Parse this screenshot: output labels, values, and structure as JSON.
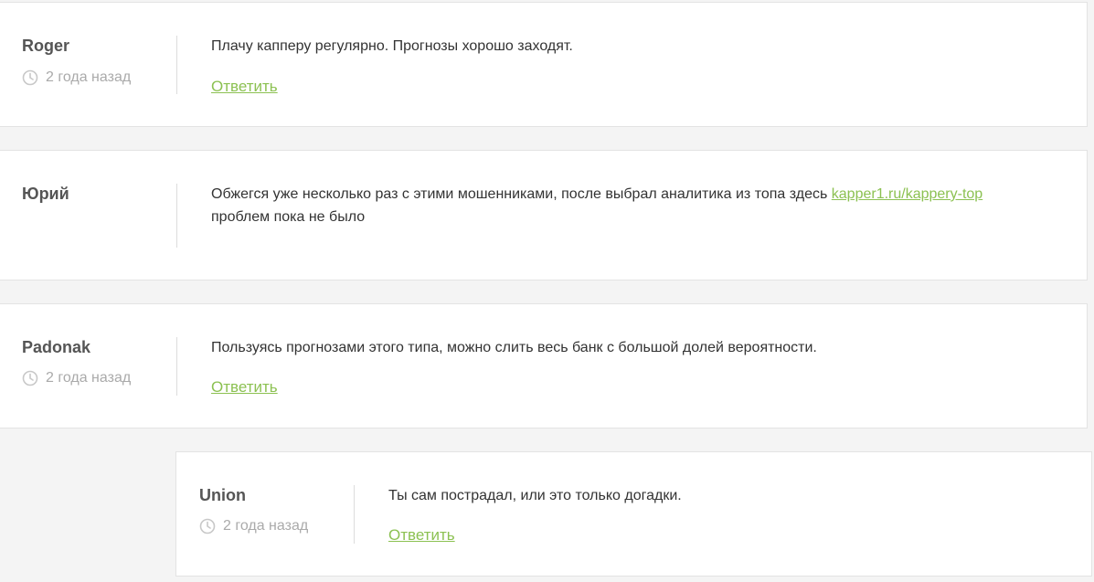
{
  "colors": {
    "accent": "#8cc152",
    "background": "#f4f4f4",
    "card": "#ffffff",
    "muted": "#aaaaaa"
  },
  "comments": [
    {
      "author": "Roger",
      "time": "2 года назад",
      "text": "Плачу капперу регулярно. Прогнозы хорошо заходят.",
      "reply_label": "Ответить"
    },
    {
      "author": "Юрий",
      "text_before": "Обжегся уже несколько раз с этими мошенниками, после выбрал аналитика из топа здесь",
      "link": "kapper1.ru/kappery-top",
      "text_after": "проблем пока не было"
    },
    {
      "author": "Padonak",
      "time": "2 года назад",
      "text": "Пользуясь прогнозами этого типа, можно слить весь банк с большой долей вероятности.",
      "reply_label": "Ответить"
    },
    {
      "author": "Union",
      "time": "2 года назад",
      "text": "Ты сам пострадал, или это только догадки.",
      "reply_label": "Ответить"
    }
  ]
}
